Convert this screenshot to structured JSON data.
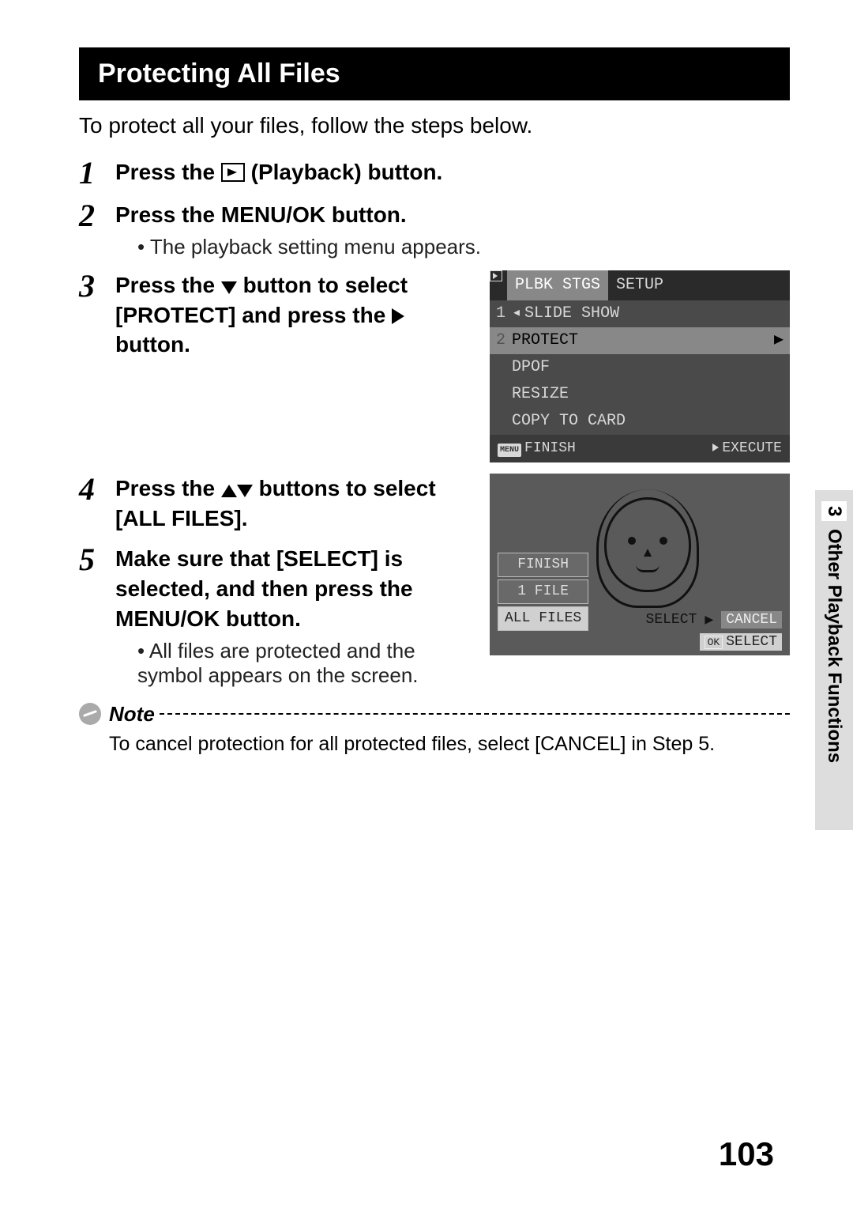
{
  "title": "Protecting All Files",
  "intro": "To protect all your files, follow the steps below.",
  "steps": {
    "s1": {
      "num": "1",
      "pre": "Press the ",
      "post": " (Playback) button."
    },
    "s2": {
      "num": "2",
      "title": "Press the MENU/OK button.",
      "sub": "The playback setting menu appears."
    },
    "s3": {
      "num": "3",
      "l1": "Press the ",
      "l2": " button to select",
      "l3": "[PROTECT] and press the ",
      "l4": "button."
    },
    "s4": {
      "num": "4",
      "l1": "Press the ",
      "l2": " buttons to select",
      "l3": "[ALL FILES]."
    },
    "s5": {
      "num": "5",
      "title": "Make sure that [SELECT] is selected, and then press the MENU/OK button.",
      "sub": "All files are protected and the symbol appears on the screen."
    }
  },
  "note": {
    "label": "Note",
    "body": "To cancel protection for all protected files, select [CANCEL] in Step 5."
  },
  "lcd1": {
    "tab_active": "PLBK STGS",
    "tab_inactive": "SETUP",
    "items": [
      "SLIDE SHOW",
      "PROTECT",
      "DPOF",
      "RESIZE",
      "COPY TO CARD"
    ],
    "nums": [
      "1",
      "2"
    ],
    "footer_left_badge": "MENU",
    "footer_left": "FINISH",
    "footer_right": "EXECUTE"
  },
  "lcd2": {
    "opts": [
      "FINISH",
      "1 FILE",
      "ALL FILES"
    ],
    "bottom_select": "SELECT",
    "bottom_cancel": "CANCEL",
    "ok_badge": "OK",
    "ok_label": "SELECT"
  },
  "side": {
    "chapter": "3",
    "label": "Other Playback Functions"
  },
  "page_number": "103"
}
